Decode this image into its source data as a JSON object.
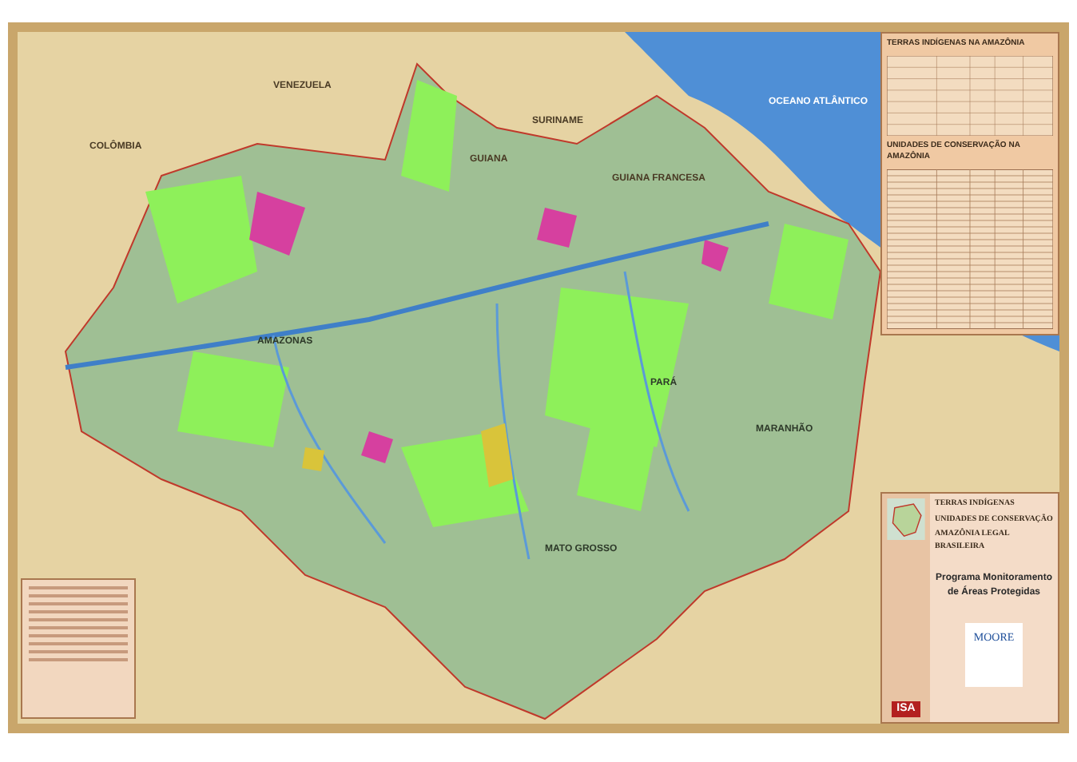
{
  "map": {
    "labels": [
      {
        "text": "COLÔMBIA",
        "kind": "country"
      },
      {
        "text": "VENEZUELA",
        "kind": "country"
      },
      {
        "text": "GUIANA",
        "kind": "country"
      },
      {
        "text": "SURINAME",
        "kind": "country"
      },
      {
        "text": "GUIANA FRANCESA",
        "kind": "country"
      },
      {
        "text": "OCEANO ATLÂNTICO",
        "kind": "ocean"
      },
      {
        "text": "AMAZONAS",
        "kind": "state"
      },
      {
        "text": "PARÁ",
        "kind": "state"
      },
      {
        "text": "MARANHÃO",
        "kind": "state"
      },
      {
        "text": "MATO GROSSO",
        "kind": "state"
      }
    ]
  },
  "indigenous_panel": {
    "title": "TERRAS INDÍGENAS NA AMAZÔNIA"
  },
  "conservation_panel": {
    "title": "UNIDADES DE CONSERVAÇÃO NA AMAZÔNIA"
  },
  "title_panel": {
    "lines": [
      "TERRAS INDÍGENAS",
      "UNIDADES DE CONSERVAÇÃO",
      "AMAZÔNIA LEGAL BRASILEIRA"
    ],
    "program": "Programa Monitoramento de Áreas Protegidas",
    "sponsor": "MOORE",
    "logo": "ISA"
  }
}
